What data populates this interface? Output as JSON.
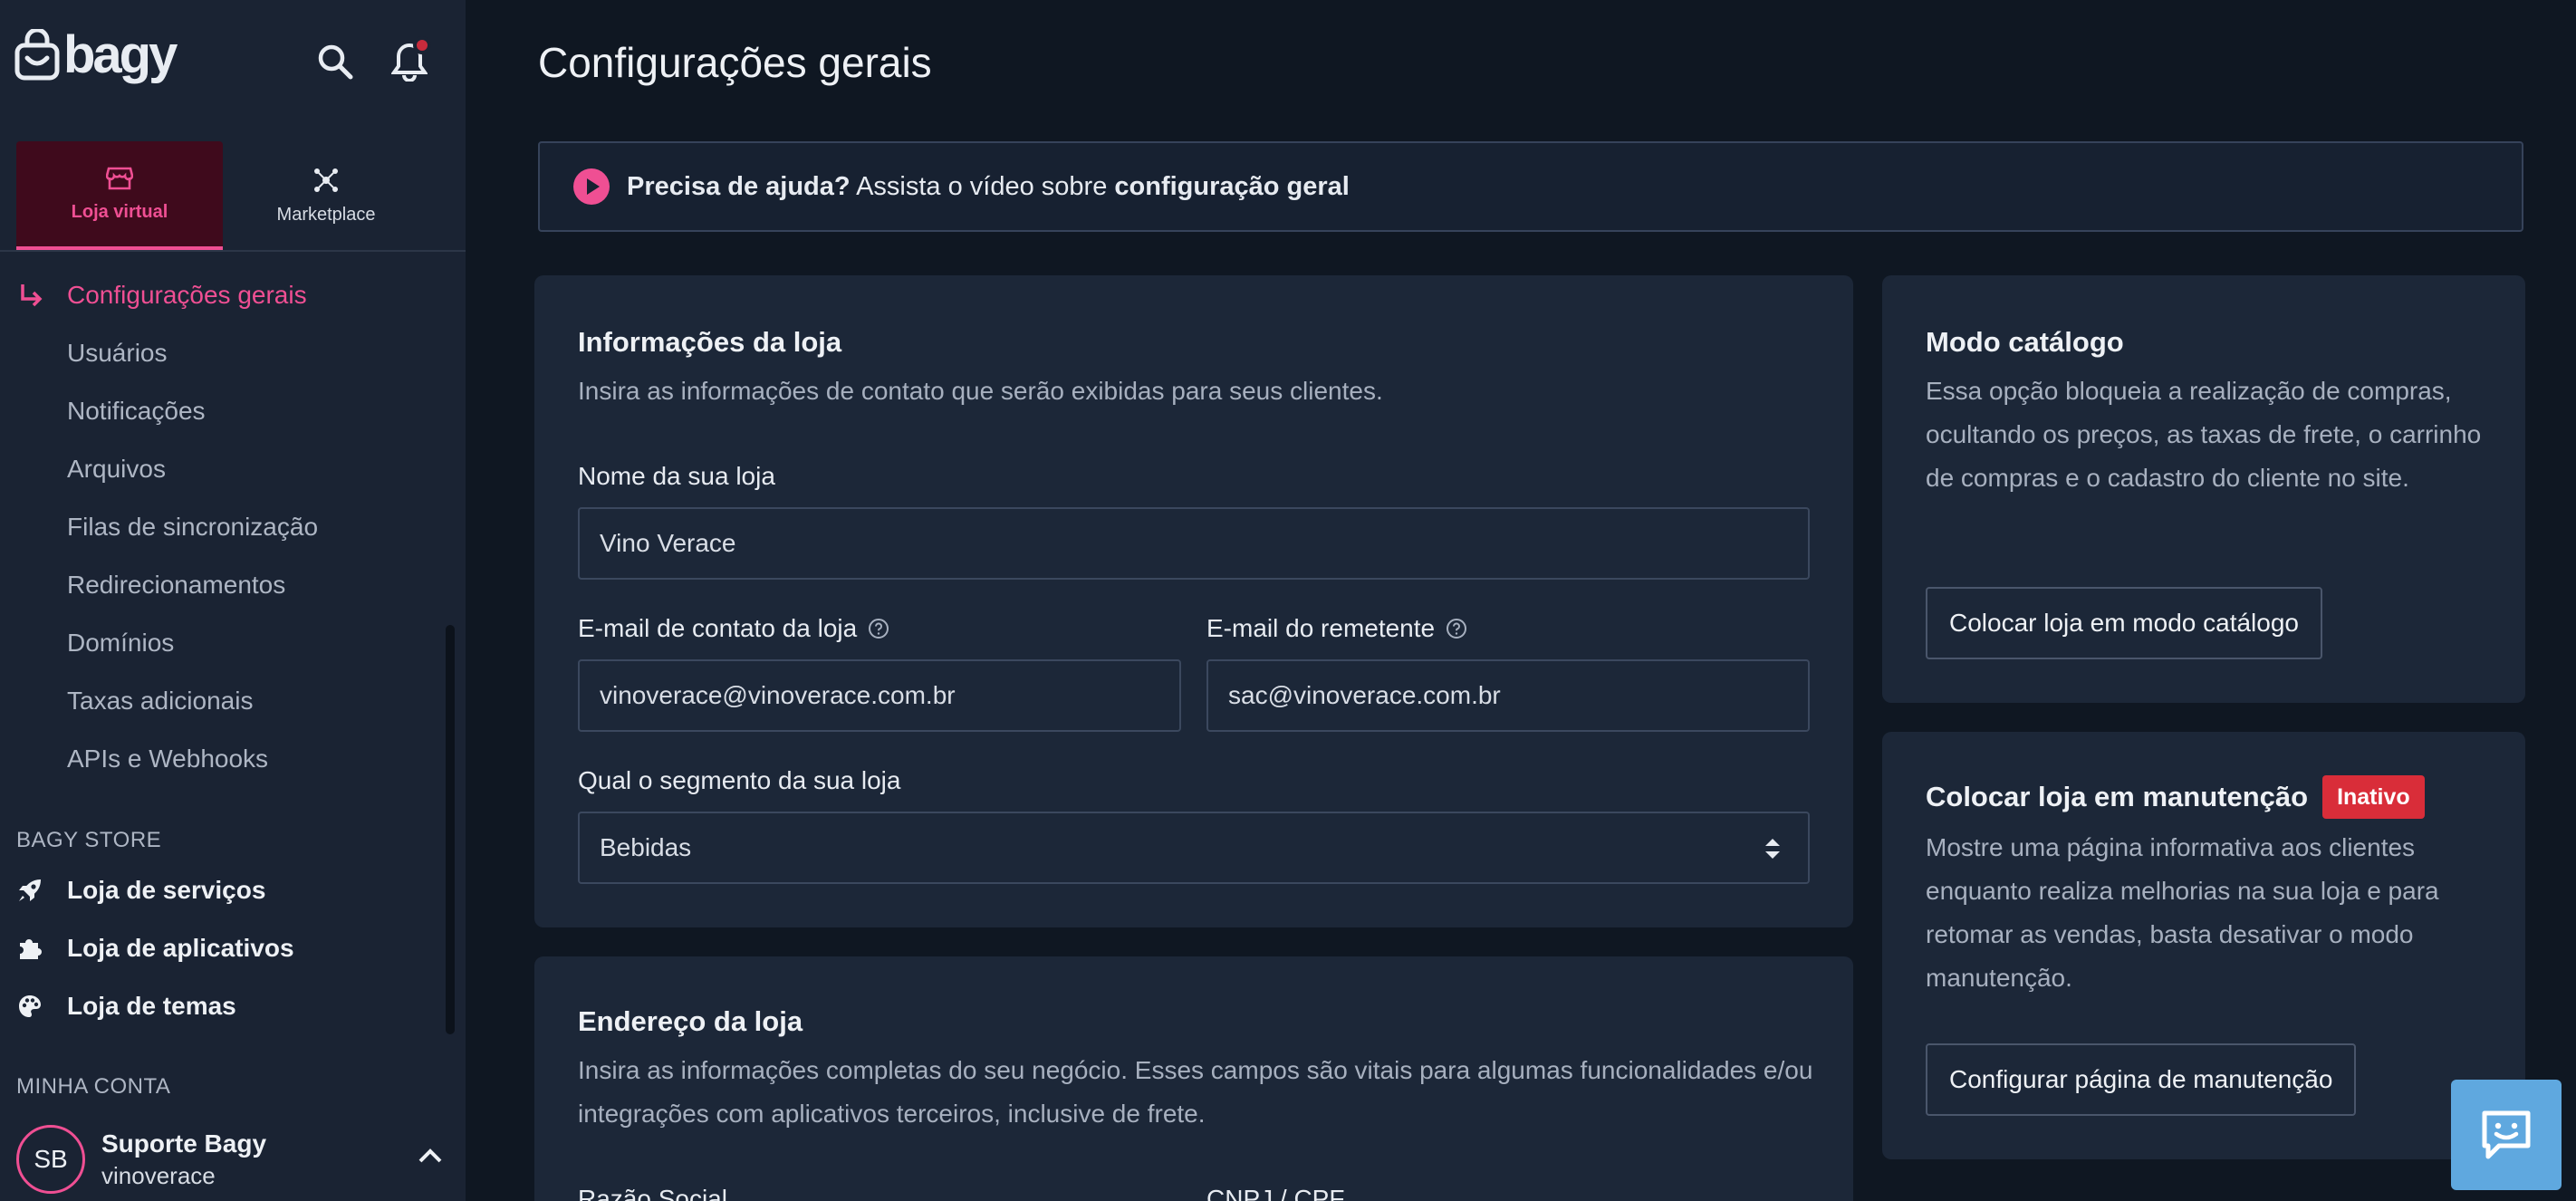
{
  "brand": {
    "logo_text": "bagy",
    "accent": "#ef4f93"
  },
  "sidebar": {
    "tabs": [
      {
        "label": "Loja virtual",
        "icon": "storefront-icon",
        "active": true
      },
      {
        "label": "Marketplace",
        "icon": "nodes-icon",
        "active": false
      }
    ],
    "nav_items": [
      {
        "label": "Configurações gerais",
        "active": true
      },
      {
        "label": "Usuários"
      },
      {
        "label": "Notificações"
      },
      {
        "label": "Arquivos"
      },
      {
        "label": "Filas de sincronização"
      },
      {
        "label": "Redirecionamentos"
      },
      {
        "label": "Domínios"
      },
      {
        "label": "Taxas adicionais"
      },
      {
        "label": "APIs e Webhooks"
      }
    ],
    "bagy_store": {
      "title": "BAGY STORE",
      "items": [
        {
          "label": "Loja de serviços",
          "icon": "rocket-icon"
        },
        {
          "label": "Loja de aplicativos",
          "icon": "puzzle-icon"
        },
        {
          "label": "Loja de temas",
          "icon": "palette-icon"
        }
      ]
    },
    "account": {
      "title": "MINHA CONTA",
      "initials": "SB",
      "name": "Suporte Bagy",
      "store": "vinoverace"
    }
  },
  "main": {
    "title": "Configurações gerais",
    "help": {
      "strong": "Precisa de ajuda?",
      "text": " Assista o vídeo sobre ",
      "link": "configuração geral"
    },
    "store_info": {
      "title": "Informações da loja",
      "description": "Insira as informações de contato que serão exibidas para seus clientes.",
      "name_label": "Nome da sua loja",
      "name_value": "Vino Verace",
      "email_label": "E-mail de contato da loja",
      "email_value": "vinoverace@vinoverace.com.br",
      "sender_label": "E-mail do remetente",
      "sender_value": "sac@vinoverace.com.br",
      "segment_label": "Qual o segmento da sua loja",
      "segment_value": "Bebidas"
    },
    "address": {
      "title": "Endereço da loja",
      "description": "Insira as informações completas do seu negócio. Esses campos são vitais para algumas funcionalidades e/ou integrações com aplicativos terceiros, inclusive de frete.",
      "company_label": "Razão Social",
      "doc_label": "CNPJ / CPF"
    },
    "catalog": {
      "title": "Modo catálogo",
      "description": "Essa opção bloqueia a realização de compras, ocultando os preços, as taxas de frete, o carrinho de compras e o cadastro do cliente no site.",
      "button": "Colocar loja em modo catálogo"
    },
    "maintenance": {
      "title": "Colocar loja em manutenção",
      "badge": "Inativo",
      "badge_color": "#d92d39",
      "description": "Mostre uma página informativa aos clientes enquanto realiza melhorias na sua loja e para retomar as vendas, basta desativar o modo manutenção.",
      "button": "Configurar página de manutenção"
    }
  }
}
